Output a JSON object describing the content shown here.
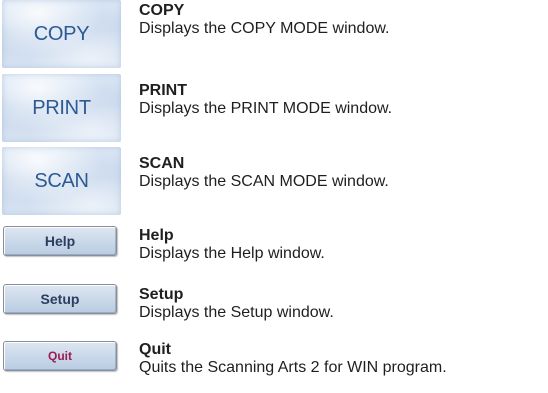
{
  "items": [
    {
      "button": "COPY",
      "title": "COPY",
      "desc": "Displays the COPY MODE window."
    },
    {
      "button": "PRINT",
      "title": "PRINT",
      "desc": "Displays the PRINT MODE window."
    },
    {
      "button": "SCAN",
      "title": "SCAN",
      "desc": "Displays the SCAN MODE window."
    },
    {
      "button": "Help",
      "title": "Help",
      "desc": "Displays the Help window."
    },
    {
      "button": "Setup",
      "title": "Setup",
      "desc": "Displays the Setup window."
    },
    {
      "button": "Quit",
      "title": "Quit",
      "desc": "Quits the Scanning Arts 2 for WIN program."
    }
  ],
  "colors": {
    "large_button_text": "#2c5a93",
    "small_button_text": "#2a3e5e",
    "quit_text": "#9b1b52"
  }
}
